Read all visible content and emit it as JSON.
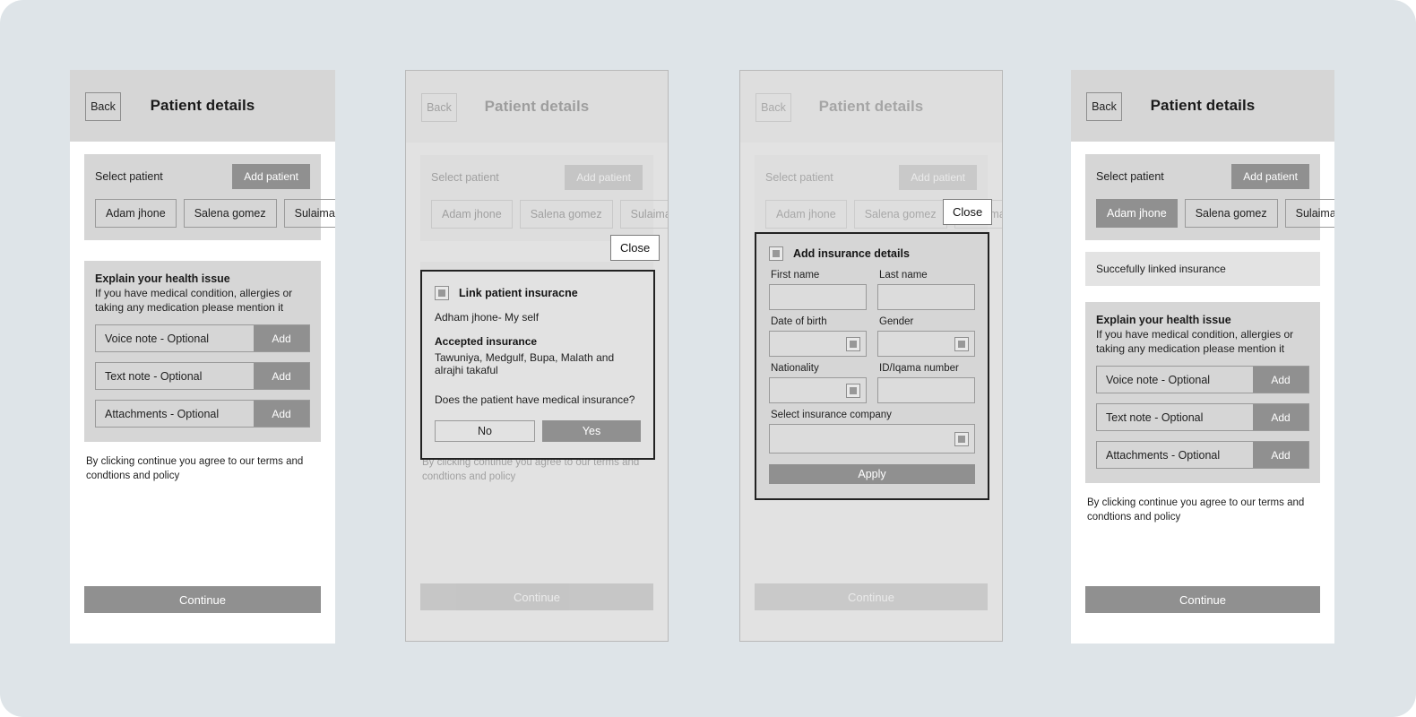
{
  "common": {
    "back_label": "Back",
    "title": "Patient details",
    "select_patient_label": "Select patient",
    "add_patient_label": "Add patient",
    "patients": [
      "Adam jhone",
      "Salena gomez",
      "Sulaiman azee"
    ],
    "issue_title": "Explain your health issue",
    "issue_sub": "If you have medical condition, allergies or taking any medication please mention it",
    "notes": [
      {
        "label": "Voice note - Optional",
        "action": "Add"
      },
      {
        "label": "Text note - Optional",
        "action": "Add"
      },
      {
        "label": "Attachments - Optional",
        "action": "Add"
      }
    ],
    "terms": "By clicking continue you agree to our terms and condtions and policy",
    "continue_label": "Continue",
    "close_label": "Close",
    "checkbox_icon": "filled-square-icon",
    "dropdown_icon": "dropdown-square-icon"
  },
  "panel2": {
    "modal": {
      "title": "Link patient insuracne",
      "patient_line": "Adham jhone- My self",
      "accepted_heading": "Accepted insurance",
      "accepted_list": "Tawuniya, Medgulf, Bupa, Malath and alrajhi takaful",
      "question": "Does the patient have medical insurance?",
      "no_label": "No",
      "yes_label": "Yes"
    }
  },
  "panel3": {
    "sheet": {
      "title": "Add insurance details",
      "fields": [
        {
          "label": "First name",
          "value": "",
          "type": "text"
        },
        {
          "label": "Last name",
          "value": "",
          "type": "text"
        },
        {
          "label": "Date of birth",
          "value": "",
          "type": "select"
        },
        {
          "label": "Gender",
          "value": "",
          "type": "select"
        },
        {
          "label": "Nationality",
          "value": "",
          "type": "select"
        },
        {
          "label": "ID/Iqama number",
          "value": "",
          "type": "text"
        }
      ],
      "company_label": "Select insurance company",
      "apply_label": "Apply"
    }
  },
  "panel4": {
    "selected_patient": "Adam jhone",
    "success_message": "Succefully linked insurance"
  },
  "colors": {
    "page_background": "#dee4e8",
    "header_gray": "#d6d6d6",
    "accent_gray": "#909090",
    "border_gray": "#9a9a9a",
    "modal_border": "#222222"
  }
}
